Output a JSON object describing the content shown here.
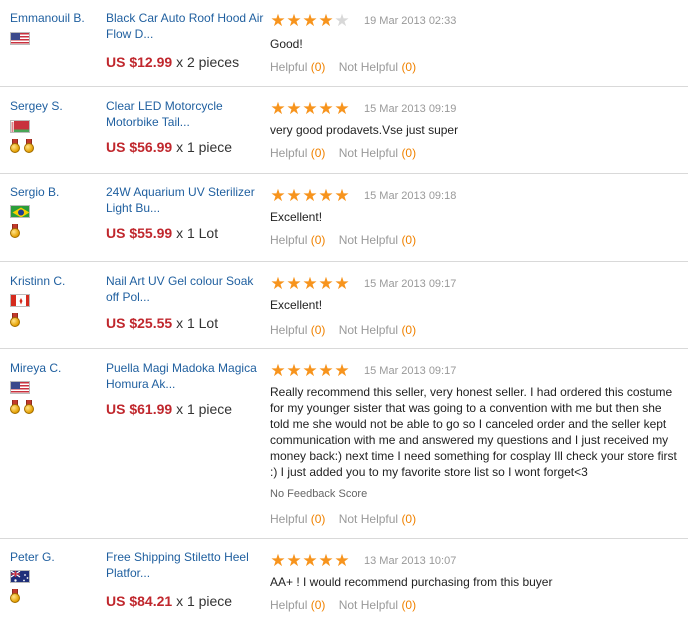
{
  "reviews": [
    {
      "buyer": "Emmanouil B.",
      "flag": "us",
      "medals": 0,
      "product": "Black Car Auto Roof Hood Air Flow D...",
      "price": "US $12.99",
      "quantity": "x 2 pieces",
      "stars": 4,
      "date": "19 Mar 2013 02:33",
      "comment": "Good!",
      "no_feedback": "",
      "helpful_label": "Helpful",
      "helpful_count": "(0)",
      "not_helpful_label": "Not Helpful",
      "not_helpful_count": "(0)"
    },
    {
      "buyer": "Sergey S.",
      "flag": "by",
      "medals": 2,
      "product": "Clear LED Motorcycle Motorbike Tail...",
      "price": "US $56.99",
      "quantity": "x 1 piece",
      "stars": 5,
      "date": "15 Mar 2013 09:19",
      "comment": "very good prodavets.Vse just super",
      "no_feedback": "",
      "helpful_label": "Helpful",
      "helpful_count": "(0)",
      "not_helpful_label": "Not Helpful",
      "not_helpful_count": "(0)"
    },
    {
      "buyer": "Sergio B.",
      "flag": "br",
      "medals": 1,
      "product": "24W Aquarium UV Sterilizer Light Bu...",
      "price": "US $55.99",
      "quantity": "x 1 Lot",
      "stars": 5,
      "date": "15 Mar 2013 09:18",
      "comment": "Excellent!",
      "no_feedback": "",
      "helpful_label": "Helpful",
      "helpful_count": "(0)",
      "not_helpful_label": "Not Helpful",
      "not_helpful_count": "(0)"
    },
    {
      "buyer": "Kristinn C.",
      "flag": "ca",
      "medals": 1,
      "product": "Nail Art UV Gel colour Soak off Pol...",
      "price": "US $25.55",
      "quantity": "x 1 Lot",
      "stars": 5,
      "date": "15 Mar 2013 09:17",
      "comment": "Excellent!",
      "no_feedback": "",
      "helpful_label": "Helpful",
      "helpful_count": "(0)",
      "not_helpful_label": "Not Helpful",
      "not_helpful_count": "(0)"
    },
    {
      "buyer": "Mireya C.",
      "flag": "us",
      "medals": 2,
      "product": "Puella Magi Madoka Magica Homura Ak...",
      "price": "US $61.99",
      "quantity": "x 1 piece",
      "stars": 5,
      "date": "15 Mar 2013 09:17",
      "comment": "Really recommend this seller, very honest seller. I had ordered this costume for my younger sister that was going to a convention with me but then she told me she would not be able to go so I canceled order and the seller kept communication with me and answered my questions and I just received my money back:) next time I need something for cosplay Ill check your store first :) I just added you to my favorite store list so I wont forget<3",
      "no_feedback": "No Feedback Score",
      "helpful_label": "Helpful",
      "helpful_count": "(0)",
      "not_helpful_label": "Not Helpful",
      "not_helpful_count": "(0)"
    },
    {
      "buyer": "Peter G.",
      "flag": "au",
      "medals": 1,
      "product": "Free Shipping Stiletto Heel Platfor...",
      "price": "US $84.21",
      "quantity": "x 1 piece",
      "stars": 5,
      "date": "13 Mar 2013 10:07",
      "comment": "AA+ ! I would recommend purchasing from this buyer",
      "no_feedback": "",
      "helpful_label": "Helpful",
      "helpful_count": "(0)",
      "not_helpful_label": "Not Helpful",
      "not_helpful_count": "(0)"
    }
  ],
  "colors": {
    "link": "#1f5f9f",
    "price": "#c0272d",
    "star": "#f7941d",
    "count": "#f08200"
  }
}
